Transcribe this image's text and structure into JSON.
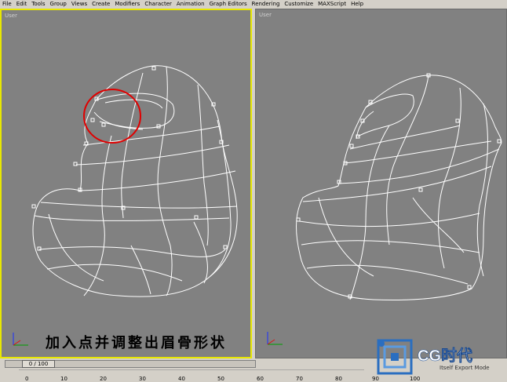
{
  "menu": [
    "File",
    "Edit",
    "Tools",
    "Group",
    "Views",
    "Create",
    "Modifiers",
    "Character",
    "Animation",
    "Graph Editors",
    "Rendering",
    "Customize",
    "MAXScript",
    "Help"
  ],
  "viewports": {
    "left": {
      "label": "User"
    },
    "right": {
      "label": "User"
    }
  },
  "caption": "加入点并调整出眉骨形状",
  "timeline": {
    "frame_display": "0 / 100",
    "ticks": [
      "0",
      "10",
      "20",
      "30",
      "40",
      "50",
      "60",
      "70",
      "80",
      "90",
      "100"
    ]
  },
  "logo": {
    "text": "CG时代"
  },
  "status": "Itself Export Mode",
  "colors": {
    "active_viewport_border": "#e8e800",
    "viewport_bg": "#818181",
    "mesh": "#ffffff",
    "highlight_circle": "#e00000"
  }
}
